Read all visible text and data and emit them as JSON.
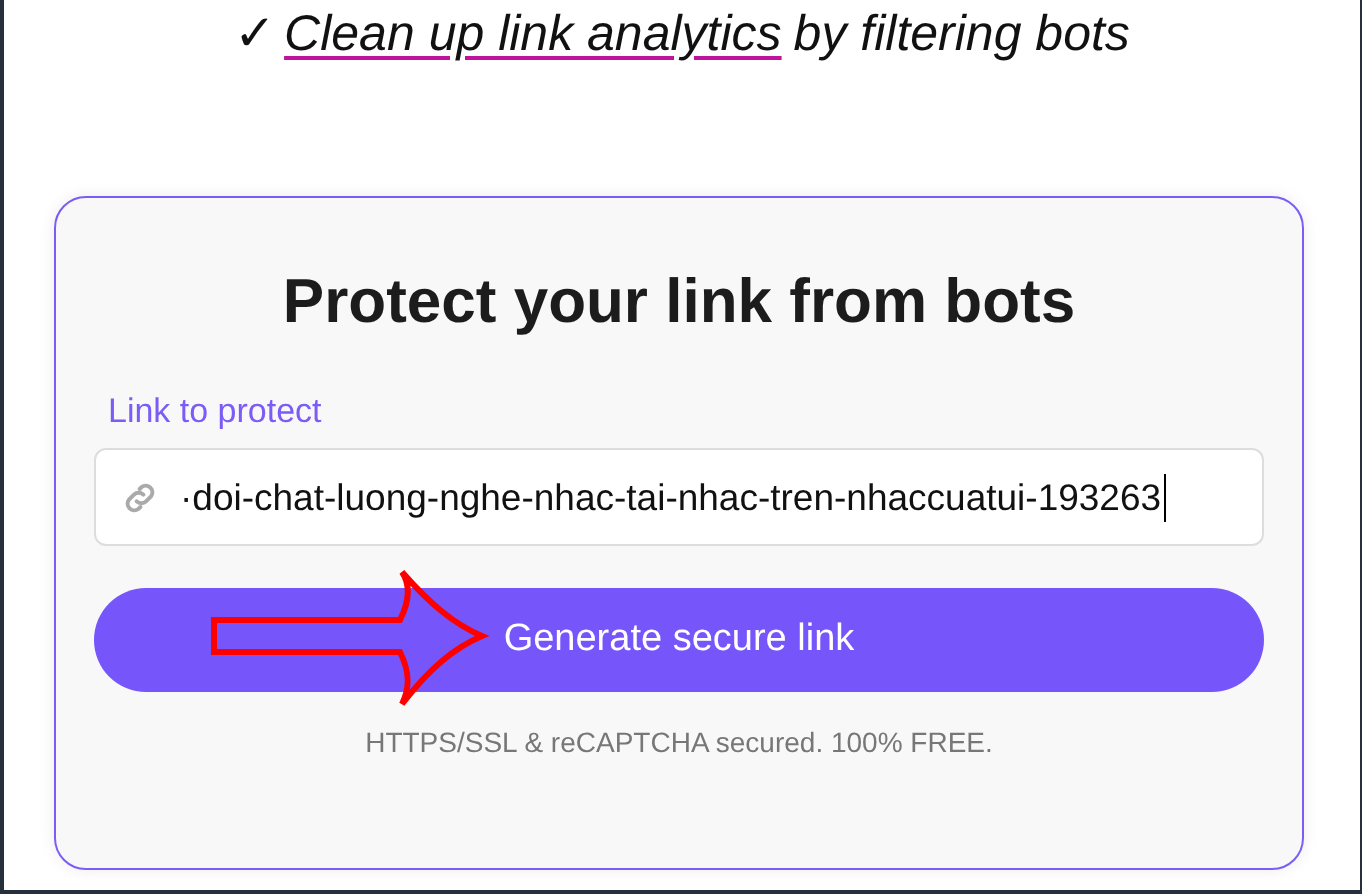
{
  "headline": {
    "mark": "✓",
    "link": "Clean up link analytics",
    "rest": "by filtering bots"
  },
  "card": {
    "title": "Protect your link from bots",
    "field_label": "Link to protect",
    "field_value": "·doi-chat-luong-nghe-nhac-tai-nhac-tren-nhaccuatui-193263",
    "button": "Generate secure link",
    "note": "HTTPS/SSL & reCAPTCHA secured. 100% FREE."
  },
  "annotation": {
    "kind": "arrow"
  }
}
